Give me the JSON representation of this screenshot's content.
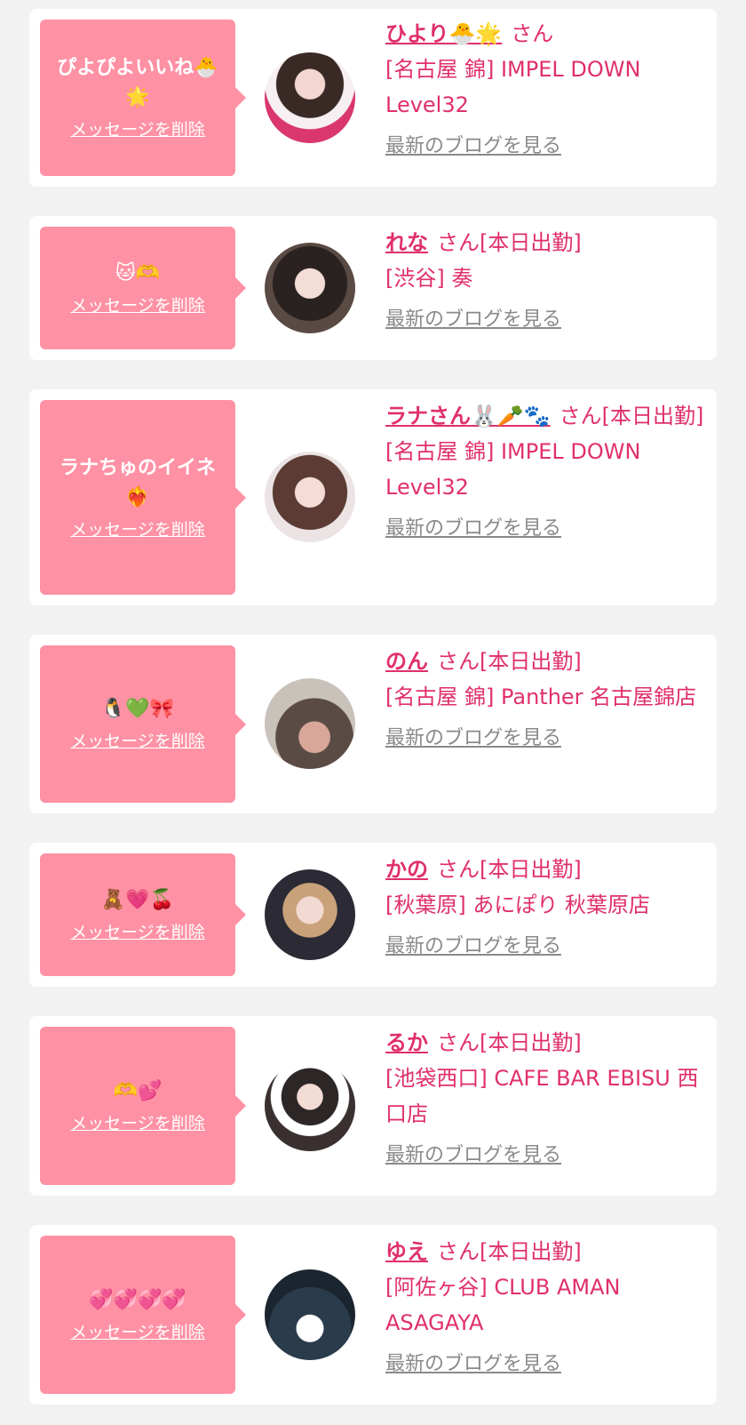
{
  "accent_color": "#e0306a",
  "bubble_color": "#ff91a4",
  "delete_label": "メッセージを削除",
  "blog_label": "最新のブログを見る",
  "cards": [
    {
      "message": "ぴよぴよいいね🐣🌟",
      "name": "ひより🐣🌟",
      "suffix": "さん",
      "shop": "[名古屋 錦] IMPEL DOWN Level32"
    },
    {
      "message": "🐱🫶",
      "name": "れな",
      "suffix": "さん[本日出勤]",
      "shop": "[渋谷] 奏"
    },
    {
      "message": "ラナちゅのイイネ❤️‍🔥",
      "name": "ラナさん🐰🥕🐾",
      "suffix": "さん[本日出勤]",
      "shop": "[名古屋 錦] IMPEL DOWN Level32"
    },
    {
      "message": "🐧💚🎀",
      "name": "のん",
      "suffix": "さん[本日出勤]",
      "shop": "[名古屋 錦] Panther 名古屋錦店"
    },
    {
      "message": "🧸💗🍒",
      "name": "かの",
      "suffix": "さん[本日出勤]",
      "shop": "[秋葉原] あにぽり 秋葉原店"
    },
    {
      "message": "🫶💕",
      "name": "るか",
      "suffix": "さん[本日出勤]",
      "shop": "[池袋西口] CAFE BAR EBISU 西口店"
    },
    {
      "message": "💞💞💞💞",
      "name": "ゆえ",
      "suffix": "さん[本日出勤]",
      "shop": "[阿佐ヶ谷] CLUB AMAN ASAGAYA"
    }
  ]
}
